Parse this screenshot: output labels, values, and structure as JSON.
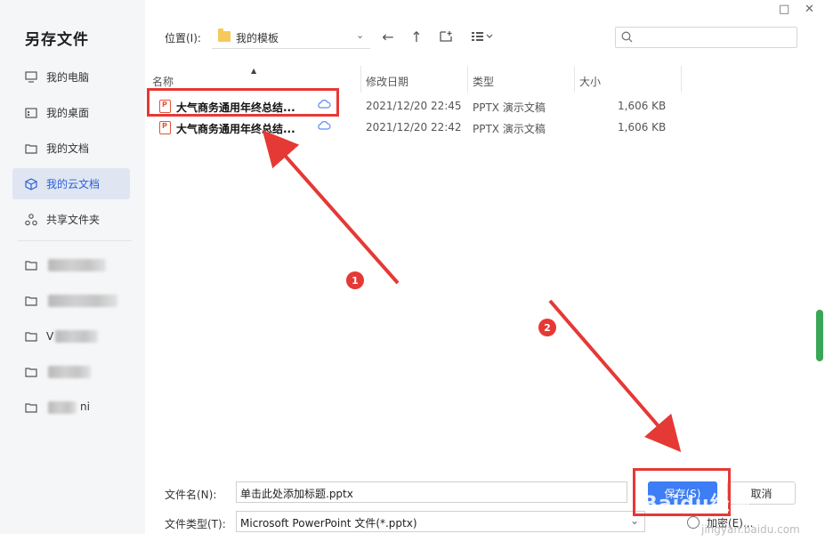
{
  "dialog": {
    "title": "另存文件"
  },
  "window_controls": {
    "maximize": "□",
    "close": "✕"
  },
  "sidebar": {
    "items": [
      {
        "label": "我的电脑",
        "icon": "monitor-icon"
      },
      {
        "label": "我的桌面",
        "icon": "desktop-icon"
      },
      {
        "label": "我的文档",
        "icon": "folder-icon"
      },
      {
        "label": "我的云文档",
        "icon": "cloud-cube-icon",
        "active": true
      },
      {
        "label": "共享文件夹",
        "icon": "share-icon"
      }
    ],
    "recent_folders_obscured": [
      {
        "label": ""
      },
      {
        "label": ""
      },
      {
        "label": "V"
      },
      {
        "label": ""
      },
      {
        "label": "ni"
      }
    ]
  },
  "toolbar": {
    "location_label": "位置(I):",
    "location_value": "我的模板",
    "back_icon": "←",
    "up_icon": "↑",
    "new_folder_icon": "new-folder-icon",
    "view_icon": "view-list-icon",
    "search_placeholder": ""
  },
  "file_list": {
    "columns": [
      "名称",
      "修改日期",
      "类型",
      "大小"
    ],
    "rows": [
      {
        "name": "大气商务通用年终总结...",
        "modified": "2021/12/20 22:45",
        "type": "PPTX 演示文稿",
        "size": "1,606 KB"
      },
      {
        "name": "大气商务通用年终总结...",
        "modified": "2021/12/20 22:42",
        "type": "PPTX 演示文稿",
        "size": "1,606 KB"
      }
    ]
  },
  "footer": {
    "filename_label": "文件名(N):",
    "filename_value": "单击此处添加标题.pptx",
    "filetype_label": "文件类型(T):",
    "filetype_value": "Microsoft PowerPoint 文件(*.pptx)",
    "save_label": "保存(S)",
    "cancel_label": "取消",
    "encrypt_label": "加密(E)..."
  },
  "annotations": {
    "step1": "1",
    "step2": "2",
    "color": "#e53935"
  },
  "watermark": {
    "text": "Baidu经验",
    "sub": "jingyan.baidu.com"
  },
  "colors": {
    "accent": "#3d7df5",
    "active_bg": "#dfe6f2",
    "highlight": "#e53935",
    "scroll": "#3aa657"
  }
}
